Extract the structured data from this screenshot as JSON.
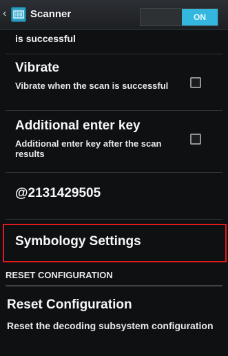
{
  "action_bar": {
    "title": "Scanner",
    "switch_state": "ON"
  },
  "preferences": {
    "partial_desc": "is successful",
    "vibrate": {
      "title": "Vibrate",
      "summary": "Vibrate when the scan is successful",
      "checked": false
    },
    "additional_enter_key": {
      "title": "Additional enter key",
      "summary": "Additional enter key after the scan results",
      "checked": false
    },
    "id_value": "@2131429505",
    "symbology_settings": "Symbology Settings",
    "reset_section_header": "RESET CONFIGURATION",
    "reset_configuration": {
      "title": "Reset Configuration",
      "summary": "Reset the decoding subsystem configuration"
    }
  },
  "colors": {
    "accent": "#34b7df",
    "highlight_border": "#e11b1b"
  }
}
